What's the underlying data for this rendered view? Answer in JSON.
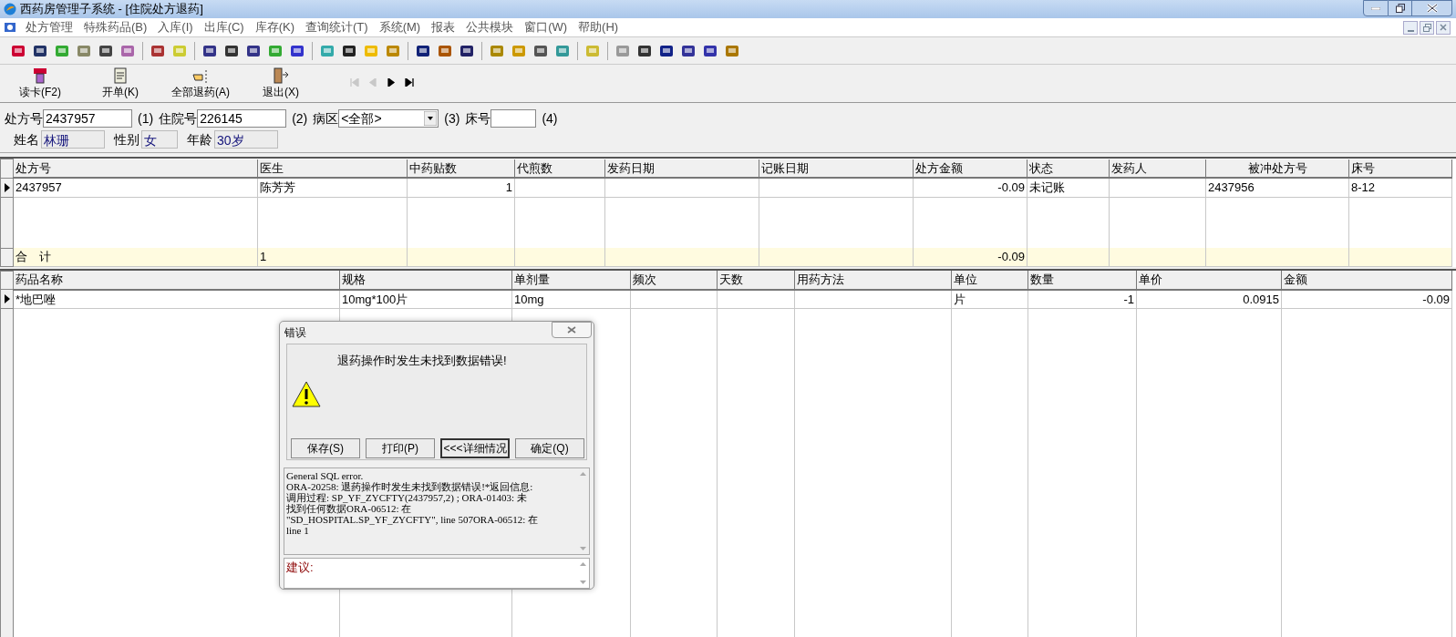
{
  "window": {
    "title": "西药房管理子系统 - [住院处方退药]"
  },
  "menu": [
    {
      "label": "处方管理"
    },
    {
      "label": "特殊药品(B)"
    },
    {
      "label": "入库(I)"
    },
    {
      "label": "出库(C)"
    },
    {
      "label": "库存(K)"
    },
    {
      "label": "查询统计(T)"
    },
    {
      "label": "系统(M)"
    },
    {
      "label": "报表"
    },
    {
      "label": "公共模块"
    },
    {
      "label": "窗口(W)"
    },
    {
      "label": "帮助(H)"
    }
  ],
  "actions": [
    {
      "label": "读卡(F2)",
      "kind": "card"
    },
    {
      "label": "开单(K)",
      "kind": "form"
    },
    {
      "label": "全部退药(A)",
      "kind": "return"
    },
    {
      "label": "退出(X)",
      "kind": "exit"
    }
  ],
  "nav": [
    {
      "kind": "first",
      "disabled": true
    },
    {
      "kind": "prev",
      "disabled": true
    },
    {
      "kind": "next",
      "disabled": false
    },
    {
      "kind": "last",
      "disabled": false
    }
  ],
  "form": {
    "row1": [
      {
        "label": "处方号",
        "value": "2437957",
        "hint": "(1)",
        "kind": "text"
      },
      {
        "label": "住院号",
        "value": "226145",
        "hint": "(2)",
        "kind": "text"
      },
      {
        "label": "病区",
        "value": "<全部>",
        "hint": "(3)",
        "kind": "select"
      },
      {
        "label": "床号",
        "hint": "(4)",
        "kind": "text"
      }
    ],
    "row2": [
      {
        "label": "姓名",
        "value": "林珊"
      },
      {
        "label": "性别",
        "value": "女"
      },
      {
        "label": "年龄",
        "value": "30岁"
      }
    ]
  },
  "prescriptions": {
    "columns": [
      "处方号",
      "医生",
      "中药贴数",
      "代煎数",
      "发药日期",
      "记账日期",
      "处方金额",
      "状态",
      "发药人",
      "被冲处方号",
      "床号"
    ],
    "rows": [
      {
        "selected": true,
        "cells": [
          "2437957",
          "陈芳芳",
          "1",
          null,
          null,
          null,
          "-0.09",
          "未记账",
          null,
          "2437956",
          "8-12"
        ]
      }
    ],
    "total": {
      "label": "合　计",
      "doctor_count": "1",
      "amount": "-0.09"
    }
  },
  "items": {
    "columns": [
      "药品名称",
      "规格",
      "单剂量",
      "频次",
      "天数",
      "用药方法",
      "单位",
      "数量",
      "单价",
      "金额"
    ],
    "rows": [
      {
        "selected": true,
        "cells": [
          "*地巴唑",
          "10mg*100片",
          "10mg",
          null,
          null,
          null,
          "片",
          "-1",
          "0.0915",
          "-0.09"
        ]
      }
    ]
  },
  "dialog": {
    "title": "错误",
    "message": "退药操作时发生未找到数据错误!",
    "buttons": [
      {
        "label": "保存(S)",
        "focused": false
      },
      {
        "label": "打印(P)",
        "focused": false
      },
      {
        "label": "<<<详细情况",
        "focused": true
      },
      {
        "label": "确定(Q)",
        "focused": false
      }
    ],
    "details": [
      "General SQL error.",
      "ORA-20258: 退药操作时发生未找到数据错误!*返回信息:",
      "调用过程: SP_YF_ZYCFTY(2437957,2) ; ORA-01403: 未",
      "找到任何数据ORA-06512: 在",
      "\"SD_HOSPITAL.SP_YF_ZYCFTY\", line 507ORA-06512: 在",
      "line 1"
    ],
    "suggestion_label": "建议:"
  }
}
